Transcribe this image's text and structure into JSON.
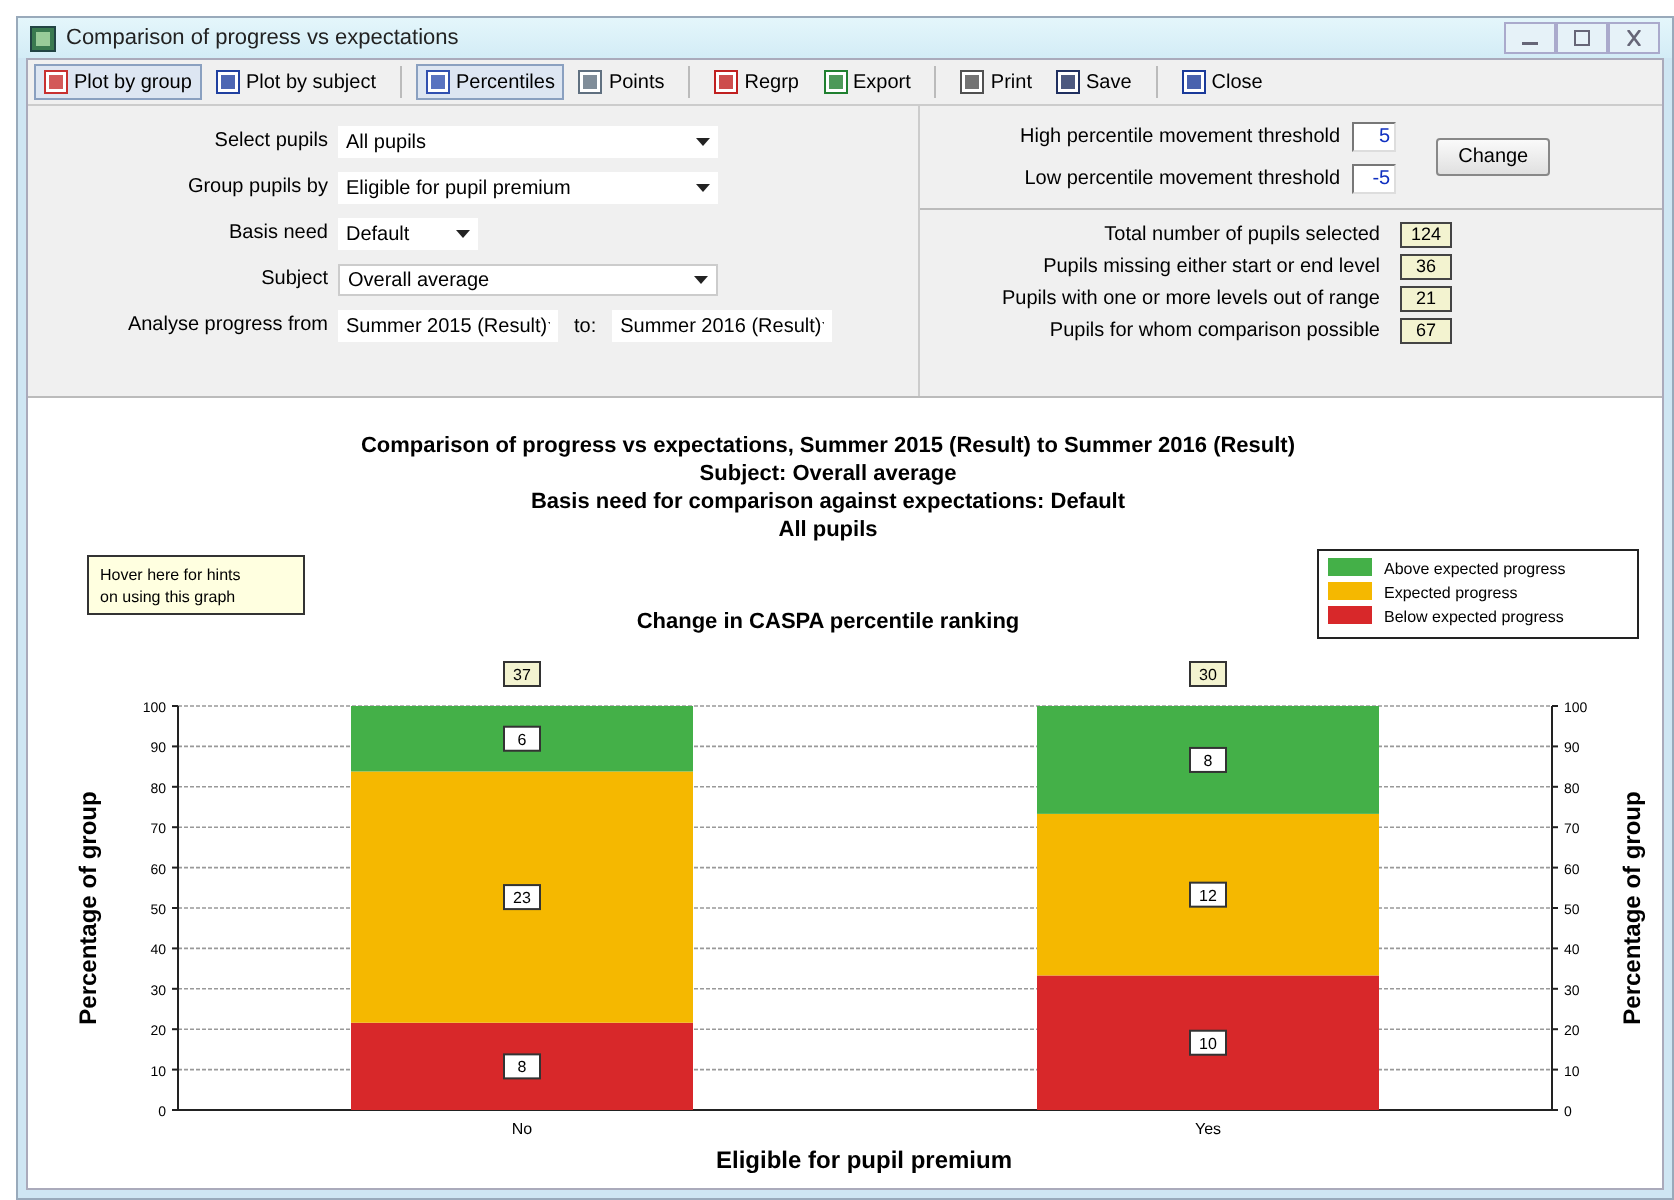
{
  "window": {
    "title": "Comparison of progress vs expectations"
  },
  "toolbar_groups": [
    [
      {
        "label": "Plot by group",
        "selected": true
      },
      {
        "label": "Plot by subject",
        "selected": false
      }
    ],
    [
      {
        "label": "Percentiles",
        "selected": true
      },
      {
        "label": "Points",
        "selected": false
      }
    ],
    [
      {
        "label": "Regrp",
        "selected": false
      },
      {
        "label": "Export",
        "selected": false
      }
    ],
    [
      {
        "label": "Print",
        "selected": false
      },
      {
        "label": "Save",
        "selected": false
      }
    ],
    [
      {
        "label": "Close",
        "selected": false
      }
    ]
  ],
  "filters": [
    {
      "label": "Select pupils",
      "fields": [
        {
          "value": "All pupils"
        }
      ]
    },
    {
      "label": "Group pupils by",
      "fields": [
        {
          "value": "Eligible for pupil premium"
        }
      ]
    },
    {
      "label": "Basis need",
      "fields": [
        {
          "value": "Default"
        }
      ]
    },
    {
      "label": "Subject",
      "fields": [
        {
          "value": "Overall average"
        }
      ]
    },
    {
      "label": "Analyse progress from",
      "fields": [
        {
          "value": "Summer 2015 (Result)"
        },
        {
          "value": "Summer 2016 (Result)",
          "prefix": "to:"
        }
      ]
    }
  ],
  "thresholds": [
    {
      "label": "High percentile movement threshold",
      "value": "5"
    },
    {
      "label": "Low percentile movement threshold",
      "value": "-5"
    }
  ],
  "change_button": "Change",
  "stats": [
    {
      "label": "Total number of pupils selected",
      "value": "124"
    },
    {
      "label": "Pupils missing either start or end level",
      "value": "36"
    },
    {
      "label": "Pupils with one or more levels out of range",
      "value": "21"
    },
    {
      "label": "Pupils for whom comparison possible",
      "value": "67"
    }
  ],
  "hint": [
    "Hover here for hints",
    "on using this graph"
  ],
  "chart": {
    "title_lines": [
      "Comparison of progress vs expectations, Summer 2015 (Result) to Summer 2016 (Result)",
      "Subject: Overall average",
      "Basis need for comparison against expectations: Default",
      "All pupils"
    ],
    "counts": [
      [
        "6",
        "23",
        "8"
      ],
      [
        "8",
        "12",
        "10"
      ]
    ],
    "totals": [
      "37",
      "30"
    ],
    "chart_data": {
      "type": "bar",
      "title": "Change in CASPA percentile ranking",
      "xlabel": "Eligible for pupil premium",
      "ylabel": "Percentage of group",
      "y2label": "Percentage of group",
      "categories": [
        "No",
        "Yes"
      ],
      "stacked": true,
      "ylim": [
        0,
        100
      ],
      "yticks": [
        0,
        10,
        20,
        30,
        40,
        50,
        60,
        70,
        80,
        90,
        100
      ],
      "y2lim": [
        0,
        100
      ],
      "y2ticks": [
        0,
        10,
        20,
        30,
        40,
        50,
        60,
        70,
        80,
        90,
        100
      ],
      "grid": true,
      "legend": true,
      "series": [
        {
          "name": "Below expected progress",
          "color": "#d8282a",
          "values": [
            21.6,
            33.3
          ]
        },
        {
          "name": "Expected progress",
          "color": "#f5b800",
          "values": [
            62.2,
            40.0
          ]
        },
        {
          "name": "Above expected progress",
          "color": "#44b048",
          "values": [
            16.2,
            26.7
          ]
        }
      ]
    }
  }
}
